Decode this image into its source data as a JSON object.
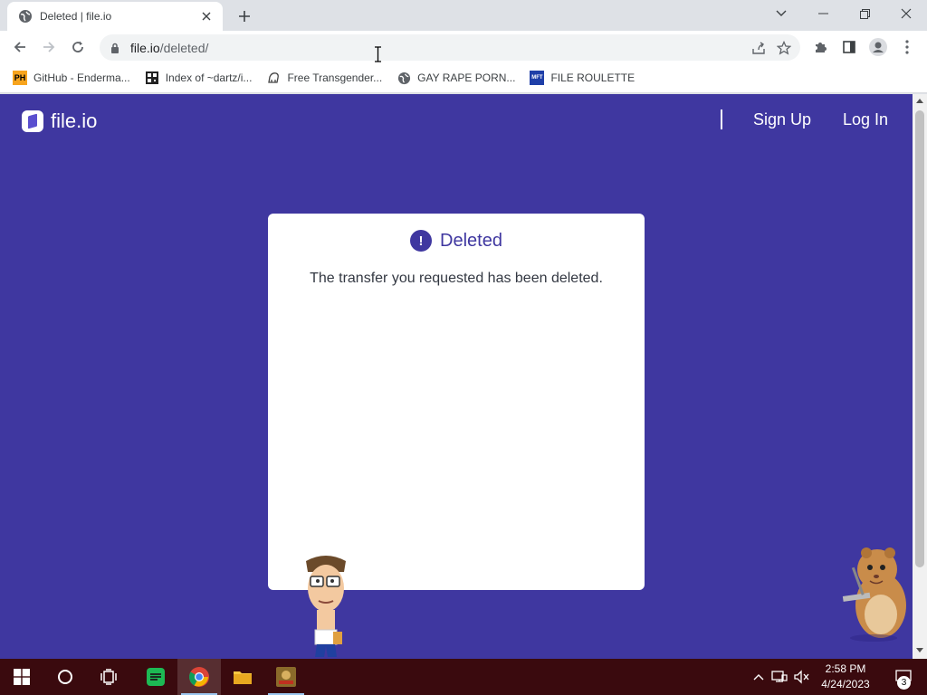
{
  "browser": {
    "tab": {
      "title": "Deleted | file.io"
    },
    "omnibox": {
      "host": "file.io",
      "path": "/deleted/"
    },
    "bookmarks": [
      {
        "label": "GitHub - Enderma...",
        "icon": "PH"
      },
      {
        "label": "Index of ~dartz/i...",
        "icon": "qr"
      },
      {
        "label": "Free Transgender...",
        "icon": "dino"
      },
      {
        "label": "GAY RAPE PORN...",
        "icon": "globe"
      },
      {
        "label": "FILE ROULETTE",
        "icon": "MFT"
      }
    ]
  },
  "page": {
    "logo_text": "file.io",
    "nav": {
      "signup": "Sign Up",
      "login": "Log In"
    },
    "card": {
      "alert_glyph": "!",
      "heading": "Deleted",
      "message": "The transfer you requested has been deleted."
    }
  },
  "taskbar": {
    "clock": {
      "time": "2:58 PM",
      "date": "4/24/2023"
    },
    "notifications_count": "3"
  },
  "colors": {
    "page_bg": "#3f37a0",
    "taskbar_bg": "#3a0a0e",
    "accent": "#3f37a0"
  }
}
